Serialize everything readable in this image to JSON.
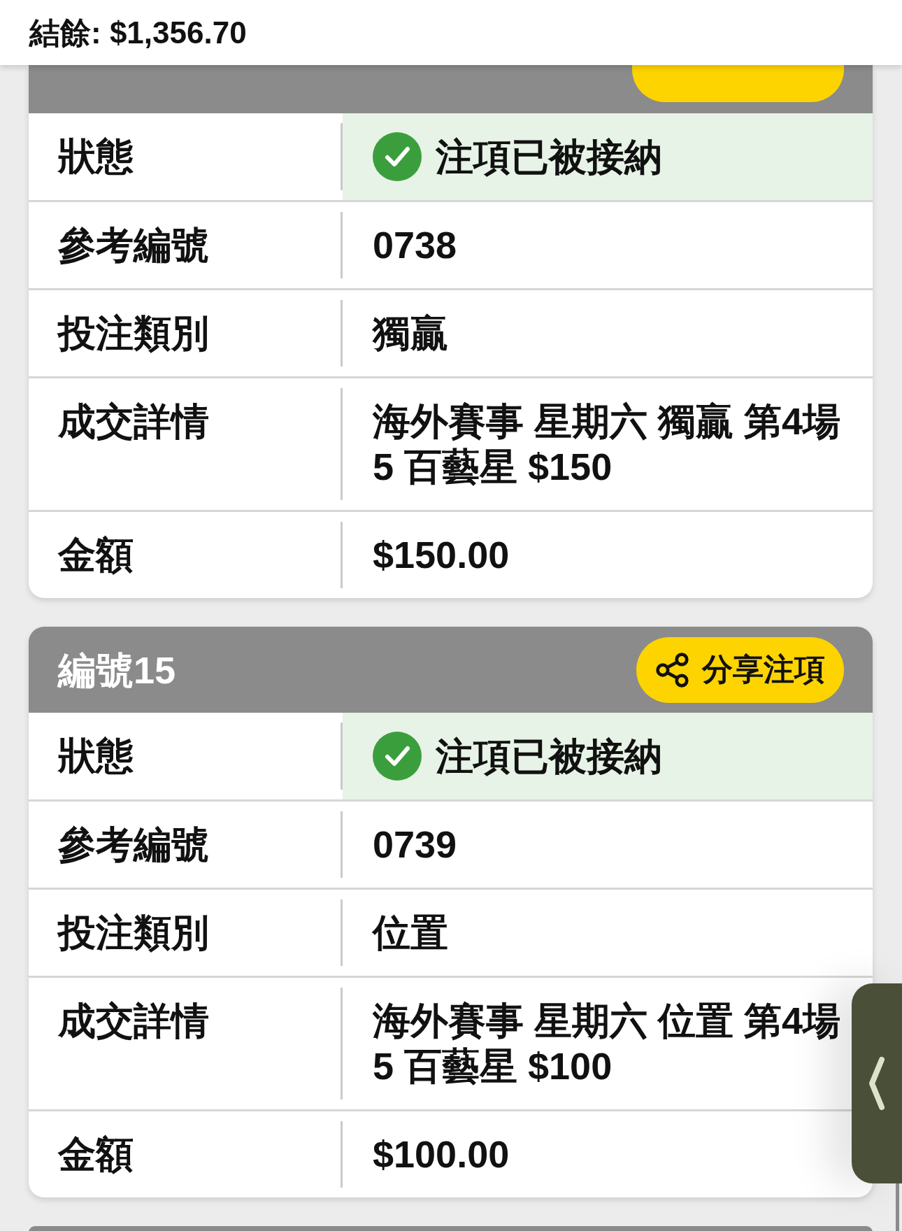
{
  "balance": "結餘: $1,356.70",
  "bets": [
    {
      "share": true,
      "rows": [
        {
          "kind": "status",
          "label": "狀態",
          "value": "注項已被接納"
        },
        {
          "kind": "text",
          "label": "參考編號",
          "value": "0738"
        },
        {
          "kind": "text",
          "label": "投注類別",
          "value": "獨贏"
        },
        {
          "kind": "text",
          "label": "成交詳情",
          "value": "海外賽事 星期六 獨贏 第4場 5 百藝星 $150"
        },
        {
          "kind": "text",
          "label": "金額",
          "value": "$150.00"
        }
      ]
    },
    {
      "title": "編號15",
      "share": true,
      "share_label": "分享注項",
      "rows": [
        {
          "kind": "status",
          "label": "狀態",
          "value": "注項已被接納"
        },
        {
          "kind": "text",
          "label": "參考編號",
          "value": "0739"
        },
        {
          "kind": "text",
          "label": "投注類別",
          "value": "位置"
        },
        {
          "kind": "text",
          "label": "成交詳情",
          "value": "海外賽事 星期六 位置 第4場 5 百藝星 $100"
        },
        {
          "kind": "text",
          "label": "金額",
          "value": "$100.00"
        }
      ]
    }
  ]
}
